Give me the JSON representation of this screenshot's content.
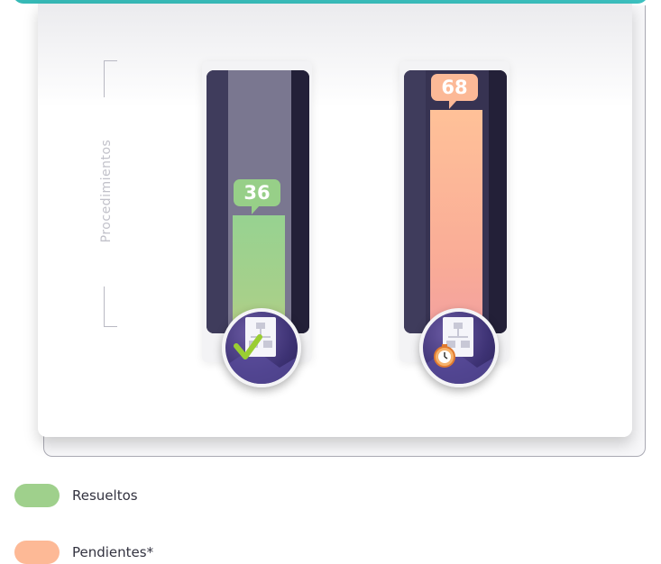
{
  "chart_data": {
    "type": "bar",
    "ylabel": "Procedimientos",
    "categories": [
      "Resueltos",
      "Pendientes*"
    ],
    "values": [
      36,
      68
    ],
    "ylim": [
      0,
      80
    ],
    "colors": [
      "#9fd08c",
      "#fdb996"
    ],
    "icons": [
      "process-completed-icon",
      "process-pending-stopwatch-icon"
    ],
    "legend": [
      {
        "label": "Resueltos",
        "color": "#9fd08c"
      },
      {
        "label": "Pendientes*",
        "color": "#fdb996"
      }
    ],
    "legend_placement": "bottom-left",
    "grid": false
  }
}
